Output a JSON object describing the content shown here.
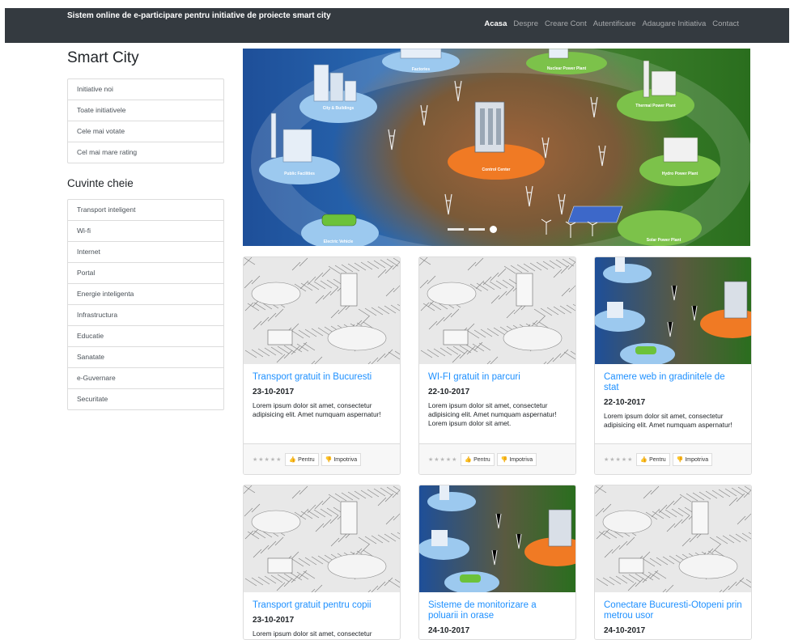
{
  "navbar": {
    "brand": "Sistem online de e-participare pentru initiative de proiecte smart city",
    "links": [
      "Acasa",
      "Despre",
      "Creare Cont",
      "Autentificare",
      "Adaugare Initiativa",
      "Contact"
    ]
  },
  "sidebar": {
    "title": "Smart City",
    "filters": [
      "Initiative noi",
      "Toate initiativele",
      "Cele mai votate",
      "Cel mai mare rating"
    ],
    "keywords_title": "Cuvinte cheie",
    "keywords": [
      "Transport inteligent",
      "Wi-fi",
      "Internet",
      "Portal",
      "Energie inteligenta",
      "Infrastructura",
      "Educatie",
      "Sanatate",
      "e-Guvernare",
      "Securitate"
    ]
  },
  "carousel": {
    "labels": [
      "City & Buildings",
      "Factories",
      "Nuclear Power Plant",
      "Thermal Power Plant",
      "Public Facilities",
      "Control Center",
      "Hydro Power Plant",
      "Electric Vehicle",
      "Solar Power Plant"
    ],
    "slide_count": 3,
    "active_slide": 3
  },
  "cards": [
    {
      "title": "Transport gratuit in Bucuresti",
      "date": "23-10-2017",
      "text": "Lorem ipsum dolor sit amet, consectetur adipisicing elit. Amet numquam aspernatur!",
      "image": "sketch"
    },
    {
      "title": "WI-FI gratuit in parcuri",
      "date": "22-10-2017",
      "text": "Lorem ipsum dolor sit amet, consectetur adipisicing elit. Amet numquam aspernatur! Lorem ipsum dolor sit amet.",
      "image": "sketch"
    },
    {
      "title": "Camere web in gradinitele de stat",
      "date": "22-10-2017",
      "text": "Lorem ipsum dolor sit amet, consectetur adipisicing elit. Amet numquam aspernatur!",
      "image": "color"
    },
    {
      "title": "Transport gratuit pentru copii",
      "date": "23-10-2017",
      "text": "Lorem ipsum dolor sit amet, consectetur",
      "image": "sketch"
    },
    {
      "title": "Sisteme de monitorizare a poluarii in orase",
      "date": "24-10-2017",
      "text": "",
      "image": "color"
    },
    {
      "title": "Conectare Bucuresti-Otopeni prin metrou usor",
      "date": "24-10-2017",
      "text": "",
      "image": "sketch"
    }
  ],
  "card_footer": {
    "stars": "★★★★★",
    "pro_label": "Pentru",
    "con_label": "Impotriva",
    "pro_icon": "thumbs-up-icon",
    "con_icon": "thumbs-down-icon"
  }
}
